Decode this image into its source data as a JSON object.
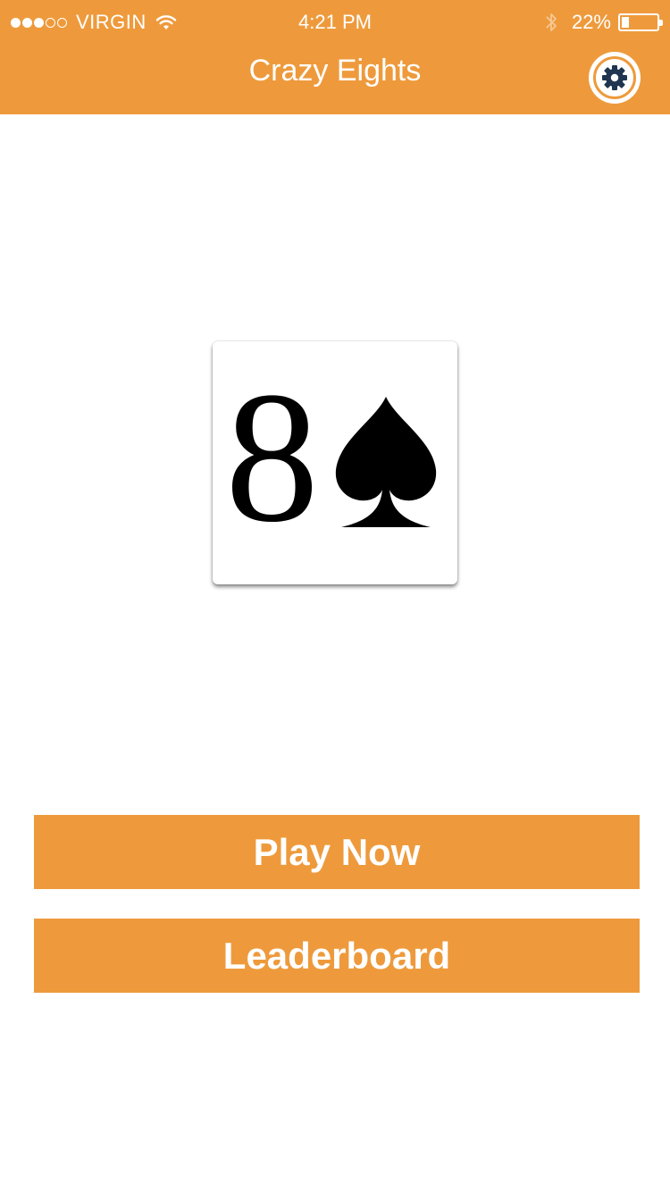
{
  "status_bar": {
    "signal_filled": 3,
    "signal_total": 5,
    "carrier": "VIRGIN",
    "time": "4:21 PM",
    "battery_percent_label": "22%",
    "battery_level": 0.22
  },
  "header": {
    "title": "Crazy Eights",
    "settings_icon": "gear-icon"
  },
  "logo": {
    "rank": "8",
    "suit_icon": "spade-icon"
  },
  "buttons": {
    "play_now": "Play Now",
    "leaderboard": "Leaderboard"
  },
  "colors": {
    "accent": "#ee9a3c",
    "gear": "#1f3550",
    "text_on_accent": "#ffffff"
  }
}
